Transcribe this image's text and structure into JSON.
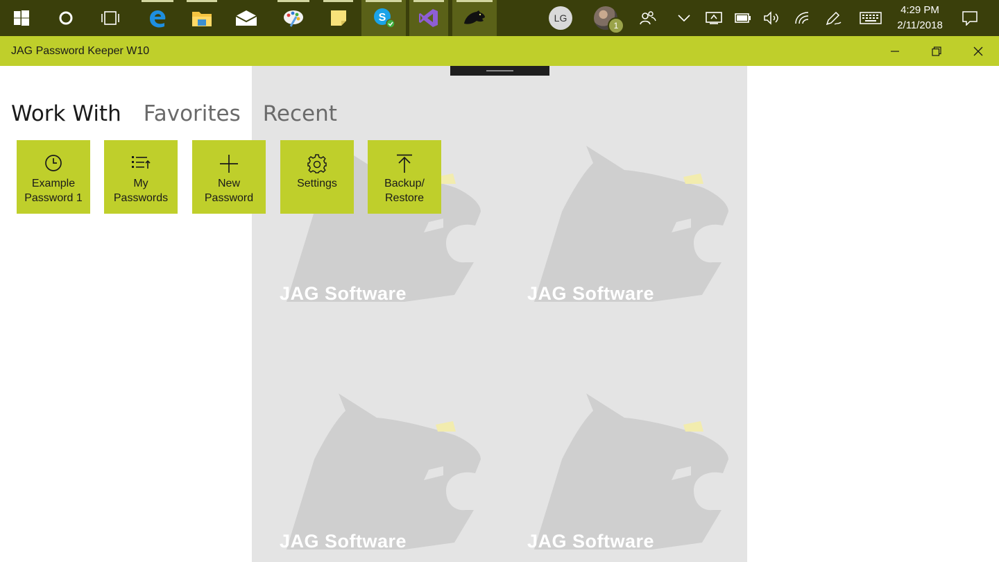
{
  "taskbar": {
    "apps": [
      {
        "name": "start-button",
        "icon": "windows-logo-icon"
      },
      {
        "name": "cortana-button",
        "icon": "cortana-circle-icon"
      },
      {
        "name": "task-view-button",
        "icon": "task-view-icon"
      },
      {
        "name": "edge",
        "icon": "edge-icon"
      },
      {
        "name": "file-explorer",
        "icon": "folder-icon"
      },
      {
        "name": "mail",
        "icon": "mail-icon"
      },
      {
        "name": "paint",
        "icon": "paint-palette-icon"
      },
      {
        "name": "sticky-notes",
        "icon": "sticky-note-icon"
      },
      {
        "name": "skype",
        "icon": "skype-icon"
      },
      {
        "name": "visual-studio",
        "icon": "visual-studio-icon"
      },
      {
        "name": "jag-password-keeper",
        "icon": "panther-icon"
      }
    ],
    "user_initials": "LG",
    "notification_count": "1",
    "clock": {
      "time": "4:29 PM",
      "date": "2/11/2018"
    }
  },
  "window": {
    "title": "JAG Password Keeper W10"
  },
  "pivot": {
    "tabs": [
      {
        "label": "Work With",
        "selected": true
      },
      {
        "label": "Favorites",
        "selected": false
      },
      {
        "label": "Recent",
        "selected": false
      }
    ]
  },
  "tiles": [
    {
      "label": "Example\nPassword 1",
      "icon": "clock-icon"
    },
    {
      "label": "My Passwords",
      "icon": "list-icon"
    },
    {
      "label": "New\nPassword",
      "icon": "plus-icon"
    },
    {
      "label": "Settings",
      "icon": "gear-icon"
    },
    {
      "label": "Backup/\nRestore",
      "icon": "upload-arrow-icon"
    }
  ],
  "watermark": {
    "text": "JAG Software"
  },
  "colors": {
    "accent": "#bfcf2b",
    "taskbar": "#3a3f0b",
    "background_panel": "#e4e4e4"
  }
}
